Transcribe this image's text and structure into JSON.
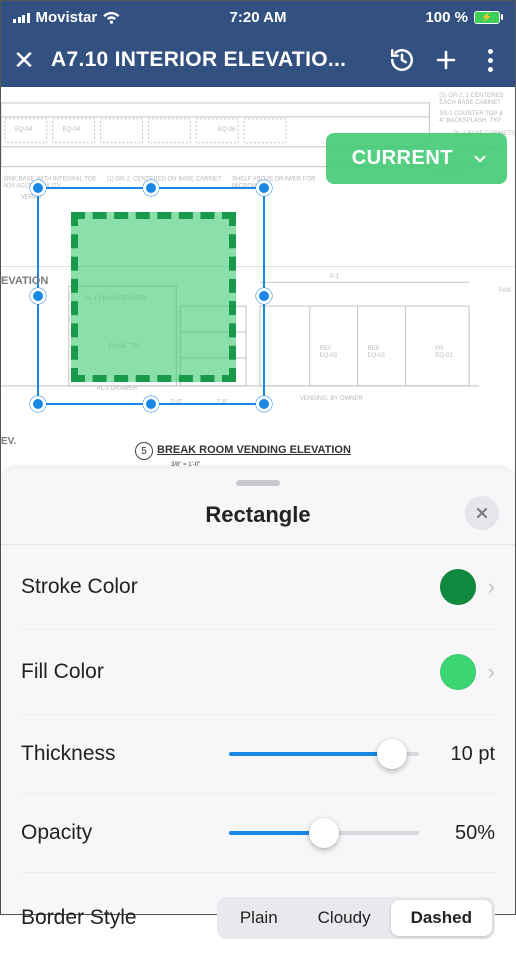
{
  "statusbar": {
    "carrier": "Movistar",
    "time": "7:20 AM",
    "battery_text": "100 %"
  },
  "header": {
    "title": "A7.10 INTERIOR ELEVATIO..."
  },
  "canvas": {
    "elevation_label": "EVATION",
    "ev_label": "EV.",
    "current_label": "CURRENT",
    "detail_number": "5",
    "detail_title": "BREAK ROOM VENDING ELEVATION",
    "detail_scale": "3/8\" = 1'-0\""
  },
  "sheet": {
    "title": "Rectangle",
    "stroke_label": "Stroke Color",
    "stroke_color": "#0f8a3f",
    "fill_label": "Fill Color",
    "fill_color": "#3bd673",
    "thickness_label": "Thickness",
    "thickness_value": "10 pt",
    "thickness_pct": 86,
    "opacity_label": "Opacity",
    "opacity_value": "50%",
    "opacity_pct": 50,
    "border_label": "Border Style",
    "border_options": [
      "Plain",
      "Cloudy",
      "Dashed"
    ],
    "border_active": 2
  }
}
